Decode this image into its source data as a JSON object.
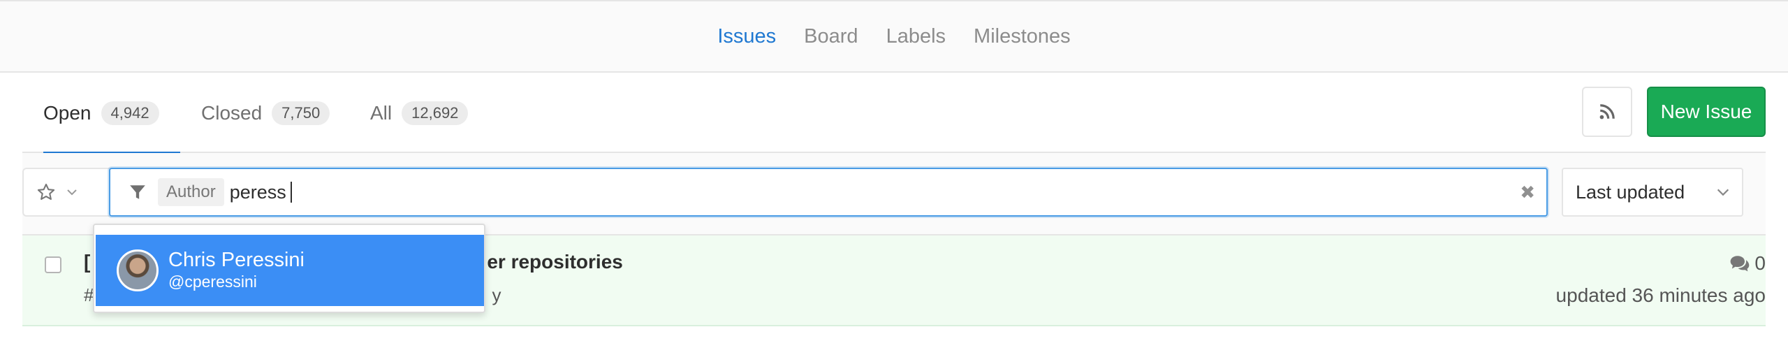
{
  "subnav": {
    "items": [
      {
        "label": "Issues",
        "active": true
      },
      {
        "label": "Board",
        "active": false
      },
      {
        "label": "Labels",
        "active": false
      },
      {
        "label": "Milestones",
        "active": false
      }
    ]
  },
  "tabs": [
    {
      "label": "Open",
      "count": "4,942",
      "active": true
    },
    {
      "label": "Closed",
      "count": "7,750",
      "active": false
    },
    {
      "label": "All",
      "count": "12,692",
      "active": false
    }
  ],
  "actions": {
    "rss_icon": "rss-icon",
    "new_issue_label": "New Issue"
  },
  "filter": {
    "token_name": "Author",
    "typed_value": "peress",
    "sort_selected": "Last updated"
  },
  "dropdown": {
    "items": [
      {
        "name": "Chris Peressini",
        "username": "@cperessini"
      }
    ]
  },
  "issue": {
    "title_visible_prefix": "[",
    "title_visible_suffix": "er repositories",
    "meta_visible_prefix": "#",
    "meta_visible_suffix": "y",
    "comments": "0",
    "updated": "updated 36 minutes ago"
  },
  "colors": {
    "accent": "#1f78d1",
    "success": "#1aaa55",
    "dropdown_highlight": "#3b8ef5",
    "row_background": "#f1fcf2"
  }
}
